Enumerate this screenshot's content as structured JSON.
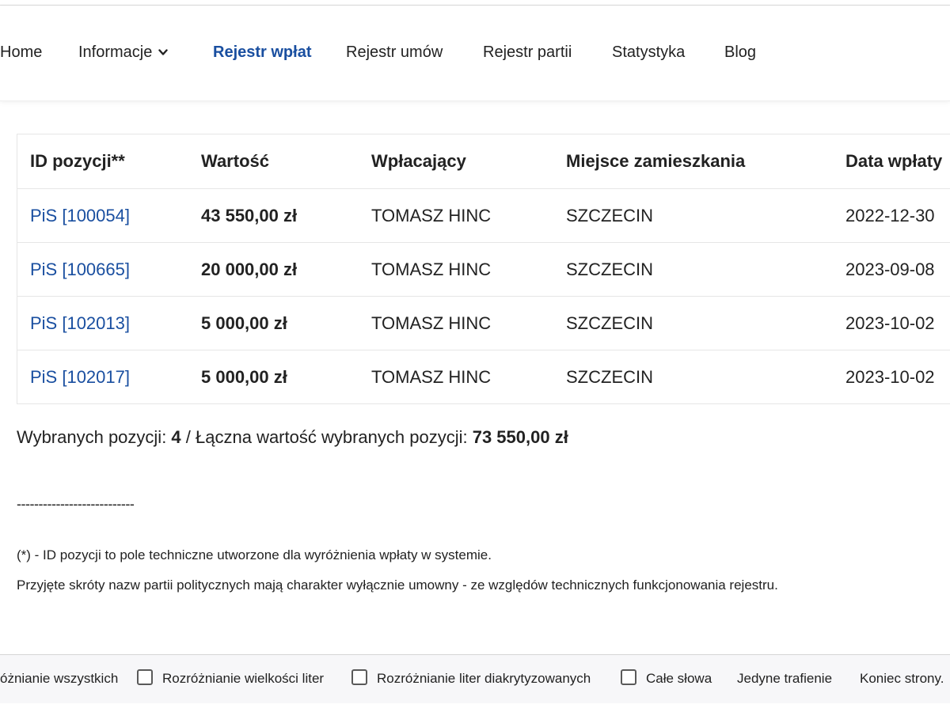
{
  "nav": {
    "home": "Home",
    "informacje": "Informacje",
    "rejestr_wplat": "Rejestr wpłat",
    "rejestr_umow": "Rejestr umów",
    "rejestr_partii": "Rejestr partii",
    "statystyka": "Statystyka",
    "blog": "Blog",
    "active_color": "#1a4fa0"
  },
  "table": {
    "headers": [
      "ID pozycji**",
      "Wartość",
      "Wpłacający",
      "Miejsce zamieszkania",
      "Data wpłaty"
    ],
    "rows": [
      {
        "id": "PiS [100054]",
        "value": "43 550,00 zł",
        "payer": "TOMASZ HINC",
        "city": "SZCZECIN",
        "date": "2022-12-30"
      },
      {
        "id": "PiS [100665]",
        "value": "20 000,00 zł",
        "payer": "TOMASZ HINC",
        "city": "SZCZECIN",
        "date": "2023-09-08"
      },
      {
        "id": "PiS [102013]",
        "value": "5 000,00 zł",
        "payer": "TOMASZ HINC",
        "city": "SZCZECIN",
        "date": "2023-10-02"
      },
      {
        "id": "PiS [102017]",
        "value": "5 000,00 zł",
        "payer": "TOMASZ HINC",
        "city": "SZCZECIN",
        "date": "2023-10-02"
      }
    ]
  },
  "summary": {
    "count_label": "Wybranych pozycji: ",
    "count": "4",
    "total_label": " / Łączna wartość wybranych pozycji: ",
    "total": "73 550,00 zł"
  },
  "footer": {
    "dashes": "---------------------------",
    "note1": "(*) - ID pozycji to pole techniczne utworzone dla wyróżnienia wpłaty w systemie.",
    "note2": "Przyjęte skróty nazw partii politycznych mają charakter wyłącznie umowny - ze względów technicznych funkcjonowania rejestru."
  },
  "findbar": {
    "highlight_all": "óżnianie wszystkich",
    "match_case": "Rozróżnianie wielkości liter",
    "match_diacritics": "Rozróżnianie liter diakrytyzowanych",
    "whole_words": "Całe słowa",
    "status": "Jedyne trafienie",
    "end_of_page": "Koniec strony."
  }
}
